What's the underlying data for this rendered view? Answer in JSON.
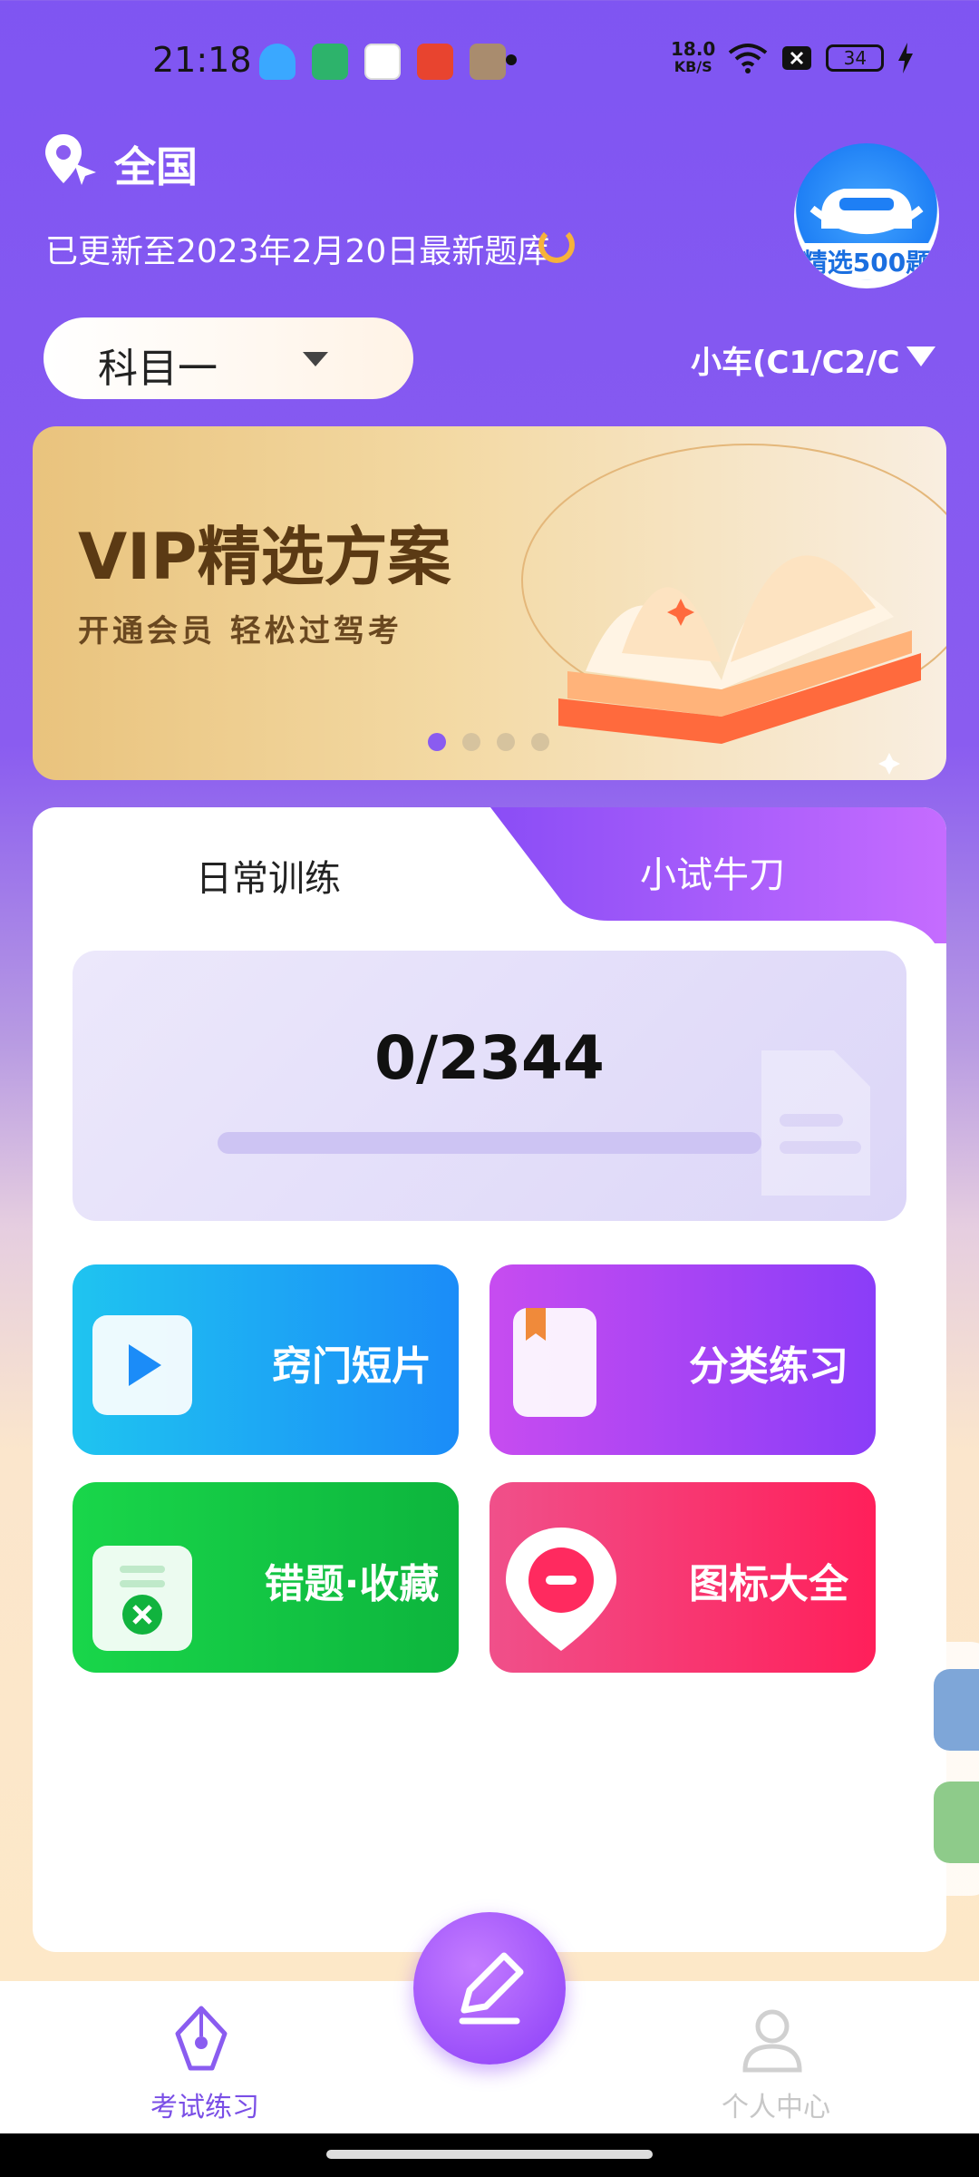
{
  "status_bar": {
    "time": "21:18",
    "speed_top": "18.0",
    "speed_bottom": "KB/S",
    "battery": "34"
  },
  "header": {
    "region": "全国",
    "update_text": "已更新至2023年2月20日最新题库",
    "badge_text": "精选500题",
    "subject_selector": "科目一",
    "vehicle_type": "小车(C1/C2/C"
  },
  "banner": {
    "title": "VIP精选方案",
    "subtitle": "开通会员 轻松过驾考",
    "active_index": 0,
    "dot_count": 4
  },
  "practice": {
    "tabs": [
      {
        "label": "日常训练"
      },
      {
        "label": "小试牛刀"
      }
    ],
    "progress": {
      "done": 0,
      "total": 2344,
      "text": "0/2344"
    },
    "tiles": [
      {
        "label": "窍门短片",
        "icon": "video-play-icon"
      },
      {
        "label": "分类练习",
        "icon": "book-icon"
      },
      {
        "label": "错题·收藏",
        "icon": "wrong-questions-icon"
      },
      {
        "label": "图标大全",
        "icon": "traffic-sign-icon"
      }
    ]
  },
  "bottom_nav": {
    "left": "考试练习",
    "right": "个人中心",
    "center_icon": "pencil-icon"
  },
  "colors": {
    "primary": "#8a5cf0",
    "accent_orange": "#f6b23a"
  }
}
